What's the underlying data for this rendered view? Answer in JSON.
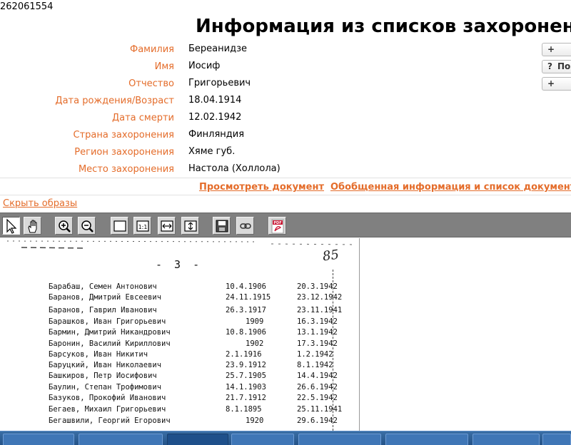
{
  "record_id": "262061554",
  "page_title": "Информация из списков захоронения",
  "fields": [
    {
      "label": "Фамилия",
      "value": "Береанидзе"
    },
    {
      "label": "Имя",
      "value": "Иосиф"
    },
    {
      "label": "Отчество",
      "value": "Григорьевич"
    },
    {
      "label": "Дата рождения/Возраст",
      "value": "18.04.1914"
    },
    {
      "label": "Дата смерти",
      "value": "12.02.1942"
    },
    {
      "label": "Страна захоронения",
      "value": "Финляндия"
    },
    {
      "label": "Регион захоронения",
      "value": "Хяме губ."
    },
    {
      "label": "Место захоронения",
      "value": "Настола (Холлола)"
    }
  ],
  "side_buttons": [
    {
      "glyph": "+",
      "label": ""
    },
    {
      "glyph": "?",
      "label": "По"
    },
    {
      "glyph": "+",
      "label": ""
    }
  ],
  "links": {
    "view_document": "Просмотреть документ",
    "summary": "Обобщенная информация и список документов",
    "hide_images": "Скрыть образы"
  },
  "toolbar": [
    {
      "name": "select-tool",
      "icon": "arrow-cursor-icon",
      "active": true
    },
    {
      "name": "pan-tool",
      "icon": "hand-icon"
    },
    {
      "name": "zoom-in",
      "icon": "zoom-in-icon"
    },
    {
      "name": "zoom-out",
      "icon": "zoom-out-icon"
    },
    {
      "name": "fit-page",
      "icon": "fit-page-icon"
    },
    {
      "name": "actual-size",
      "icon": "actual-size-icon",
      "text": "1:1"
    },
    {
      "name": "fit-width",
      "icon": "fit-width-icon"
    },
    {
      "name": "fit-height",
      "icon": "fit-height-icon"
    },
    {
      "name": "save",
      "icon": "floppy-disk-icon"
    },
    {
      "name": "link",
      "icon": "link-icon"
    },
    {
      "name": "pdf",
      "icon": "pdf-icon",
      "text": "PDF"
    }
  ],
  "document": {
    "page_number": "- 3 -",
    "corner_mark": "85",
    "rows": [
      {
        "name": "Барабаш, Семен Антонович",
        "birth": "10.4.1906",
        "death": "20.3.1942"
      },
      {
        "name": "Баранов, Дмитрий Евсеевич",
        "birth": "24.11.1915",
        "death": "23.12.1942"
      },
      {
        "name": "Баранов, Гаврил Иванович",
        "birth": "26.3.1917",
        "death": "23.11.1941"
      },
      {
        "name": "Барашков, Иван Григорьевич",
        "birth": "1909",
        "death": "16.3.1942"
      },
      {
        "name": "Бармин, Дмитрий Никандрович",
        "birth": "10.8.1906",
        "death": "13.1.1942"
      },
      {
        "name": "Баронин, Василий Кириллович",
        "birth": "1902",
        "death": "17.3.1942"
      },
      {
        "name": "Барсуков, Иван Никитич",
        "birth": "2.1.1916",
        "death": "1.2.1942"
      },
      {
        "name": "Баруцкий, Иван Николаевич",
        "birth": "23.9.1912",
        "death": "8.1.1942"
      },
      {
        "name": "Башкиров, Петр Иосифович",
        "birth": "25.7.1905",
        "death": "14.4.1942"
      },
      {
        "name": "Баулин, Степан Трофимович",
        "birth": "14.1.1903",
        "death": "26.6.1942"
      },
      {
        "name": "Базуков, Прокофий Иванович",
        "birth": "21.7.1912",
        "death": "22.5.1942"
      },
      {
        "name": "Бегаев, Михаил Григорьевич",
        "birth": "8.1.1895",
        "death": "25.11.1941"
      },
      {
        "name": "Бегашвили, Георгий Егорович",
        "birth": "1920",
        "death": "29.6.1942"
      }
    ]
  }
}
